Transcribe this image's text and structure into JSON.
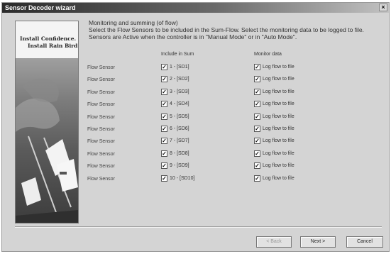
{
  "window": {
    "title": "Sensor Decoder wizard",
    "close_glyph": "×"
  },
  "side_panel": {
    "logo_line1": "Install Confidence.",
    "logo_line2": "Install Rain Bird."
  },
  "content": {
    "title": "Monitoring and summing (of flow)",
    "description": "Select the Flow Sensors to be included in the Sum-Flow. Select the monitoring data to be logged to file. Sensors are Active when the controller is in \"Manual Mode\" or in \"Auto Mode\"."
  },
  "columns": {
    "include": "Include in Sum",
    "monitor": "Monitor data"
  },
  "rows": [
    {
      "label": "Flow Sensor",
      "include": "1 - [SD1]",
      "monitor": "Log flow to file"
    },
    {
      "label": "Flow Sensor",
      "include": "2 - [SD2]",
      "monitor": "Log flow to file"
    },
    {
      "label": "Flow Sensor",
      "include": "3 - [SD3]",
      "monitor": "Log flow to file"
    },
    {
      "label": "Flow Sensor",
      "include": "4 - [SD4]",
      "monitor": "Log flow to file"
    },
    {
      "label": "Flow Sensor",
      "include": "5 - [SD5]",
      "monitor": "Log flow to file"
    },
    {
      "label": "Flow Sensor",
      "include": "6 - [SD6]",
      "monitor": "Log flow to file"
    },
    {
      "label": "Flow Sensor",
      "include": "7 - [SD7]",
      "monitor": "Log flow to file"
    },
    {
      "label": "Flow Sensor",
      "include": "8 - [SD8]",
      "monitor": "Log flow to file"
    },
    {
      "label": "Flow Sensor",
      "include": "9 - [SD9]",
      "monitor": "Log flow to file"
    },
    {
      "label": "Flow Sensor",
      "include": "10 - [SD10]",
      "monitor": "Log flow to file"
    }
  ],
  "checkbox_glyph": "✓",
  "buttons": {
    "back": "< Back",
    "next": "Next >",
    "cancel": "Cancel"
  }
}
